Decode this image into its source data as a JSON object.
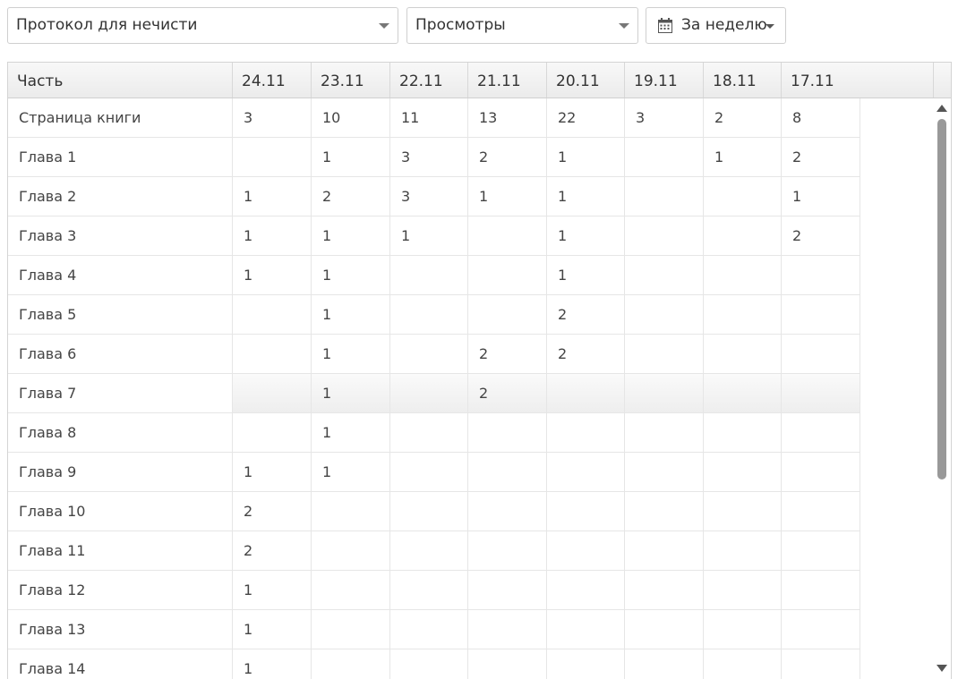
{
  "filters": {
    "protocol": "Протокол для нечисти",
    "metric": "Просмотры",
    "period": "За неделю"
  },
  "table": {
    "columns": [
      "Часть",
      "24.11",
      "23.11",
      "22.11",
      "21.11",
      "20.11",
      "19.11",
      "18.11",
      "17.11"
    ],
    "rows": [
      {
        "name": "Страница книги",
        "values": [
          "3",
          "10",
          "11",
          "13",
          "22",
          "3",
          "2",
          "8"
        ]
      },
      {
        "name": "Глава 1",
        "values": [
          "",
          "1",
          "3",
          "2",
          "1",
          "",
          "1",
          "2"
        ]
      },
      {
        "name": "Глава 2",
        "values": [
          "1",
          "2",
          "3",
          "1",
          "1",
          "",
          "",
          "1"
        ]
      },
      {
        "name": "Глава 3",
        "values": [
          "1",
          "1",
          "1",
          "",
          "1",
          "",
          "",
          "2"
        ]
      },
      {
        "name": "Глава 4",
        "values": [
          "1",
          "1",
          "",
          "",
          "1",
          "",
          "",
          ""
        ]
      },
      {
        "name": "Глава 5",
        "values": [
          "",
          "1",
          "",
          "",
          "2",
          "",
          "",
          ""
        ]
      },
      {
        "name": "Глава 6",
        "values": [
          "",
          "1",
          "",
          "2",
          "2",
          "",
          "",
          ""
        ]
      },
      {
        "name": "Глава 7",
        "values": [
          "",
          "1",
          "",
          "2",
          "",
          "",
          "",
          ""
        ]
      },
      {
        "name": "Глава 8",
        "values": [
          "",
          "1",
          "",
          "",
          "",
          "",
          "",
          ""
        ]
      },
      {
        "name": "Глава 9",
        "values": [
          "1",
          "1",
          "",
          "",
          "",
          "",
          "",
          ""
        ]
      },
      {
        "name": "Глава 10",
        "values": [
          "2",
          "",
          "",
          "",
          "",
          "",
          "",
          ""
        ]
      },
      {
        "name": "Глава 11",
        "values": [
          "2",
          "",
          "",
          "",
          "",
          "",
          "",
          ""
        ]
      },
      {
        "name": "Глава 12",
        "values": [
          "1",
          "",
          "",
          "",
          "",
          "",
          "",
          ""
        ]
      },
      {
        "name": "Глава 13",
        "values": [
          "1",
          "",
          "",
          "",
          "",
          "",
          "",
          ""
        ]
      },
      {
        "name": "Глава 14",
        "values": [
          "1",
          "",
          "",
          "",
          "",
          "",
          "",
          ""
        ]
      }
    ],
    "highlighted_row": 7
  },
  "icons": {
    "calendar": "calendar-icon",
    "dropdown": "chevron-down-icon",
    "scroll_up": "scroll-up-arrow-icon",
    "scroll_down": "scroll-down-arrow-icon"
  },
  "colors": {
    "border": "#d4d4d4",
    "header_bg": "#f0f0f0",
    "text": "#333333",
    "scroll_thumb": "#999999"
  }
}
